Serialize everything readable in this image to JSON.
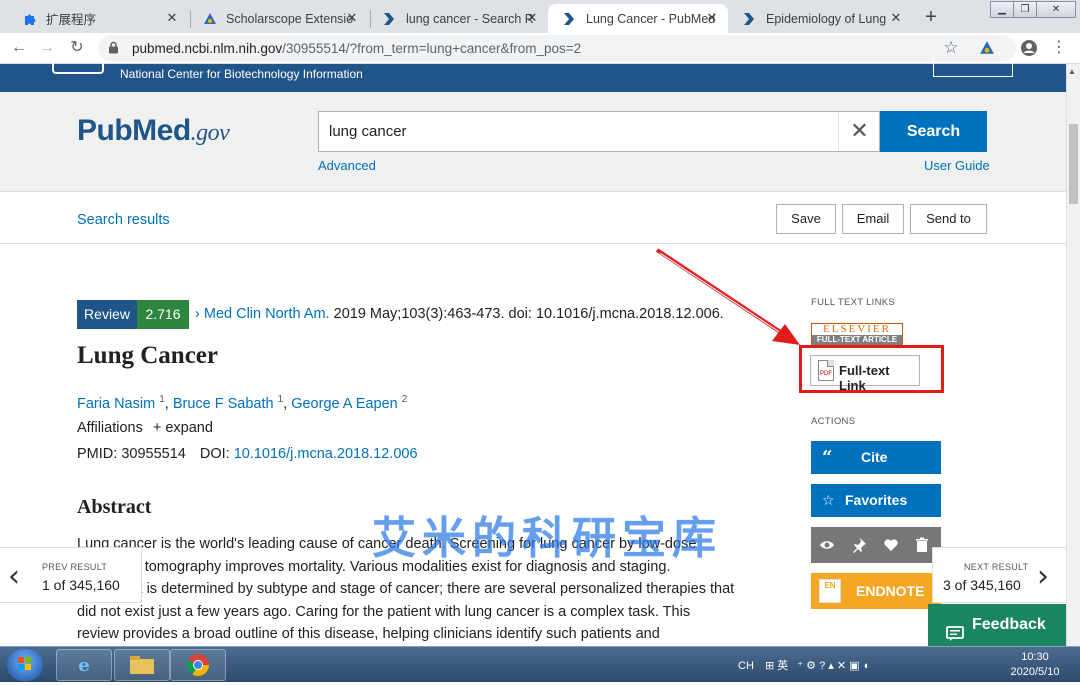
{
  "browser": {
    "tabs": [
      {
        "title": "扩展程序",
        "icon": "puzzle-icon"
      },
      {
        "title": "Scholarscope Extensio",
        "icon": "scholarscope-icon"
      },
      {
        "title": "lung cancer - Search R",
        "icon": "pubmed-tab-icon"
      },
      {
        "title": "Lung Cancer - PubMed",
        "icon": "pubmed-tab-icon",
        "active": true
      },
      {
        "title": "Epidemiology of Lung",
        "icon": "pubmed-tab-icon"
      }
    ],
    "url_host": "pubmed.ncbi.nlm.nih.gov",
    "url_path": "/30955514/?from_term=lung+cancer&from_pos=2"
  },
  "ncbi": {
    "title": "National Center for Biotechnology Information"
  },
  "search": {
    "logo_main": "PubMed",
    "logo_suffix": ".gov",
    "query": "lung cancer",
    "button": "Search",
    "advanced": "Advanced",
    "user_guide": "User Guide"
  },
  "results_bar": {
    "link": "Search results",
    "save": "Save",
    "email": "Email",
    "send_to": "Send to"
  },
  "article": {
    "badge_type": "Review",
    "impact_factor": "2.716",
    "journal": "Med Clin North Am.",
    "citation": "2019 May;103(3):463-473. doi: 10.1016/j.mcna.2018.12.006.",
    "title": "Lung Cancer",
    "authors": [
      {
        "name": "Faria Nasim",
        "aff": "1"
      },
      {
        "name": "Bruce F Sabath",
        "aff": "1"
      },
      {
        "name": "George A Eapen",
        "aff": "2"
      }
    ],
    "affiliations_label": "Affiliations",
    "expand_label": "expand",
    "pmid_label": "PMID:",
    "pmid": "30955514",
    "doi_label": "DOI:",
    "doi": "10.1016/j.mcna.2018.12.006",
    "abstract_heading": "Abstract",
    "abstract_lines": [
      "Lung cancer is the world's leading cause of cancer death. Screening for lung cancer by low-dose",
      "computed tomography improves mortality. Various modalities exist for diagnosis and staging.",
      "Treatment is determined by subtype and stage of cancer; there are several personalized therapies that",
      "did not exist just a few years ago. Caring for the patient with lung cancer is a complex task. This",
      "review provides a broad outline of this disease, helping clinicians identify such patients and"
    ]
  },
  "watermark": "艾米的科研宝库",
  "sidebar": {
    "full_text_links_label": "FULL TEXT LINKS",
    "elsevier_top": "ELSEVIER",
    "elsevier_bottom": "FULL-TEXT ARTICLE",
    "full_text_link": "Full-text Link",
    "actions_label": "ACTIONS",
    "cite": "Cite",
    "favorites": "Favorites",
    "endnote": "ENDNOTE",
    "endnote_badge": "EN"
  },
  "pager": {
    "prev_label": "PREV RESULT",
    "prev_count": "1 of 345,160",
    "next_label": "NEXT RESULT",
    "next_count": "3 of 345,160"
  },
  "feedback": "Feedback",
  "taskbar": {
    "tray": "CH",
    "tray_ime": "英",
    "time": "10:30",
    "date": "2020/5/10"
  },
  "colors": {
    "pubmed_blue": "#20558a",
    "link_blue": "#0071bc",
    "if_green": "#2e8540",
    "annotation_red": "#e21b1b",
    "feedback_green": "#1a8660",
    "endnote_orange": "#f5a623"
  }
}
